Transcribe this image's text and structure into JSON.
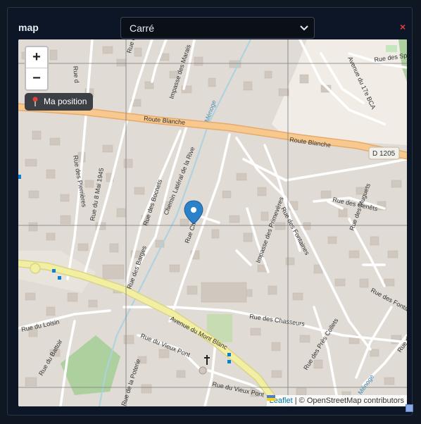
{
  "panel": {
    "title": "map",
    "close_symbol": "×",
    "accent_color": "#e0413b"
  },
  "grid_select": {
    "selected": "Carré"
  },
  "map": {
    "zoom_in": "+",
    "zoom_out": "−",
    "locate_label": "Ma position",
    "locate_icon": "pushpin-icon",
    "marker_icon": "map-marker-icon",
    "attribution": {
      "leaflet": "Leaflet",
      "separator": "|",
      "osm": "© OpenStreetMap contributors"
    },
    "colors": {
      "land": "#e0dbd5",
      "main_road": "#f7c98e",
      "primary_road": "#f2eea2",
      "minor_road": "#ffffff",
      "building": "#d0c8bf",
      "green": "#add19e",
      "water": "#aad3df",
      "marker": "#2c82c9"
    },
    "labels": {
      "route_blanche": "Route Blanche",
      "d1205": "D 1205",
      "avenue_mont_blanc": "Avenue du Mont Blanc",
      "rue_chasseurs": "Rue des Chasseurs",
      "rue_vieux_pont": "Rue du Vieux Pont",
      "rue_genets": "Rue des Genêts",
      "rue_muguets": "Rue des Muguets",
      "rue_fontaines": "Rue des Fontaines",
      "rue_fontaine": "Rue des Fontai",
      "rue_pres_collets": "Rue des Près Collets",
      "impasse_primeveres": "Impasse des Primevères",
      "rue_barges": "Rue des Barges",
      "rue_bocnets": "Rue des Bocnets",
      "chemin_lateral": "Chemin Latéral de la Rive",
      "impasse_marais": "Impasse des Marais",
      "rue_pierrieres": "Rue des Pierrières",
      "rue_8_mai": "Rue du 8 Mai 1945",
      "rue_loisin": "Rue du Loisin",
      "rue_battoir": "Rue du Battoir",
      "rue_poterie": "Rue de la Poterie",
      "avenue_17_bca": "Avenue du 17e BCA",
      "rue_sports": "Rue des Spo",
      "rue_ch": "Rue Ch",
      "menoge": "Ménoge",
      "rue_du": "Rue du",
      "rue_d": "Rue d",
      "rue_des": "Rue des"
    }
  }
}
